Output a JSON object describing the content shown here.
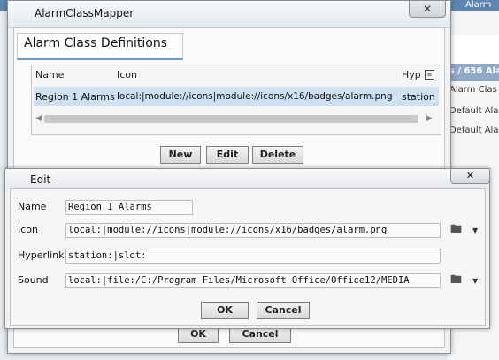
{
  "background": {
    "header_text": "s / 656 Ala",
    "col_head": "Alarm Clas",
    "rows": [
      "Default Ala",
      "Default Ala"
    ],
    "top_right": "Alarm C"
  },
  "outer_dialog": {
    "title": "AlarmClassMapper",
    "close_glyph": "✕",
    "section_title": "Alarm Class Definitions",
    "table": {
      "columns": [
        "Name",
        "Icon",
        "Hyp"
      ],
      "rows": [
        {
          "name": "Region 1 Alarms",
          "icon": "local:|module://icons|module://icons/x16/badges/alarm.png",
          "hyperlink": "station"
        }
      ]
    },
    "buttons": {
      "new": "New",
      "edit": "Edit",
      "delete": "Delete"
    },
    "footer_buttons": {
      "ok": "OK",
      "cancel": "Cancel"
    }
  },
  "edit_dialog": {
    "title": "Edit",
    "close_glyph": "✕",
    "fields": {
      "name": {
        "label": "Name",
        "value": "Region 1 Alarms"
      },
      "icon": {
        "label": "Icon",
        "value": "local:|module://icons|module://icons/x16/badges/alarm.png"
      },
      "hyperlink": {
        "label": "Hyperlink",
        "value": "station:|slot:"
      },
      "sound": {
        "label": "Sound",
        "value": "local:|file:/C:/Program Files/Microsoft Office/Office12/MEDIA"
      }
    },
    "buttons": {
      "ok": "OK",
      "cancel": "Cancel"
    },
    "icons": {
      "folder": "folder-icon",
      "dropdown": "chevron-down-icon"
    }
  }
}
